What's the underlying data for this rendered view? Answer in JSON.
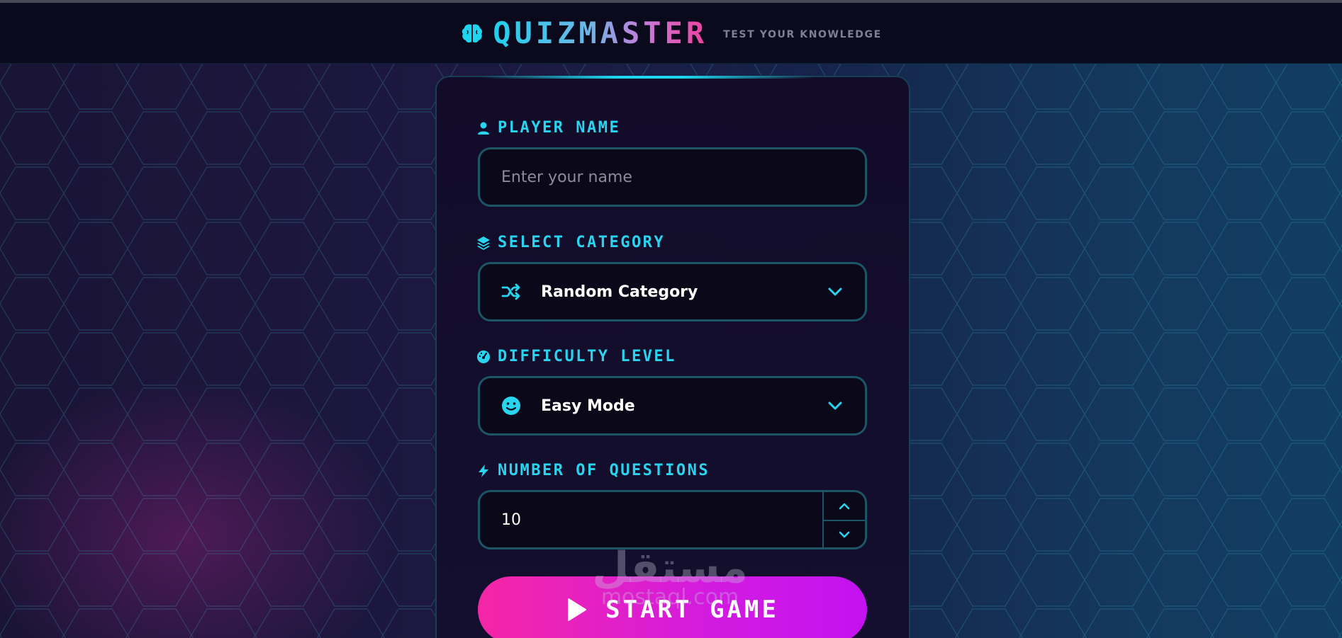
{
  "header": {
    "logo": "QUIZMASTER",
    "tagline": "TEST YOUR KNOWLEDGE",
    "logo_icon": "brain-icon"
  },
  "form": {
    "player_name": {
      "label": "PLAYER NAME",
      "icon": "user-icon",
      "placeholder": "Enter your name",
      "value": ""
    },
    "category": {
      "label": "SELECT CATEGORY",
      "icon": "layers-icon",
      "selected": "Random Category",
      "option_icon": "shuffle-icon"
    },
    "difficulty": {
      "label": "DIFFICULTY LEVEL",
      "icon": "gauge-icon",
      "selected": "Easy Mode",
      "option_icon": "smile-icon"
    },
    "questions": {
      "label": "NUMBER OF QUESTIONS",
      "icon": "bolt-icon",
      "value": "10"
    },
    "start_button": {
      "label": "START GAME",
      "icon": "play-icon"
    }
  },
  "watermark": {
    "arabic": "مستقل",
    "latin": "mostaql.com"
  },
  "colors": {
    "accent": "#29d4ef",
    "button_start": "#f526a6",
    "button_end": "#c312f0",
    "card_bg": "#120c29",
    "header_bg": "#0b0a1c"
  }
}
